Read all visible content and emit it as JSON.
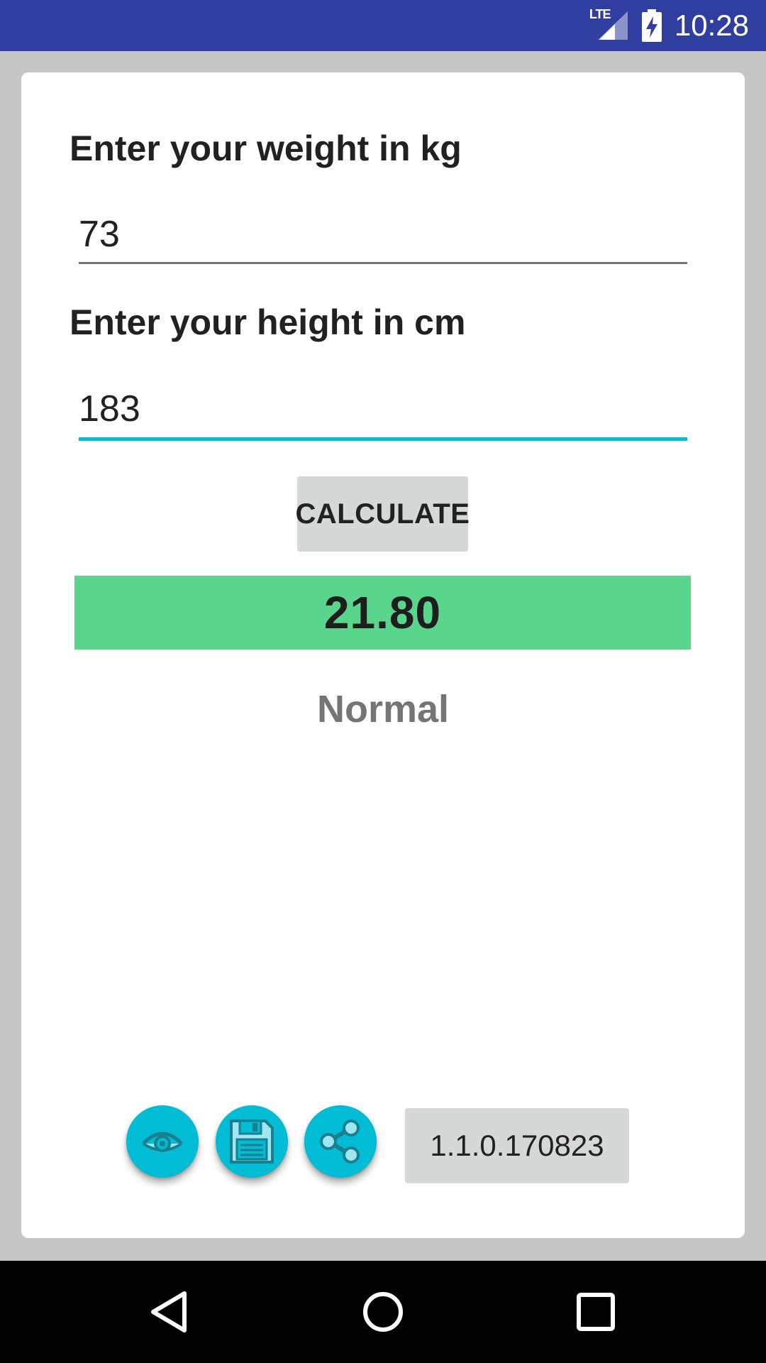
{
  "status_bar": {
    "network": "LTE",
    "time": "10:28",
    "color": "#303f9f"
  },
  "form": {
    "weight_label": "Enter your weight in kg",
    "weight_value": "73",
    "height_label": "Enter your height in cm",
    "height_value": "183",
    "active_underline_color": "#00bcd4"
  },
  "actions": {
    "calculate_label": "CALCULATE"
  },
  "result": {
    "bmi_value": "21.80",
    "category": "Normal",
    "bar_color": "#5ad68c"
  },
  "footer": {
    "icons": [
      "eye-icon",
      "save-icon",
      "share-icon"
    ],
    "version": "1.1.0.170823",
    "fab_color": "#00bcd4"
  },
  "navigation": {
    "buttons": [
      "back-icon",
      "home-icon",
      "recents-icon"
    ]
  }
}
